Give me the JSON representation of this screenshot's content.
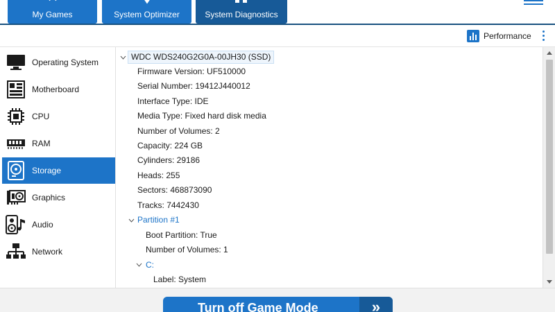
{
  "header": {
    "tabs": [
      {
        "label": "My Games",
        "icon": "gamepad-icon",
        "active": false
      },
      {
        "label": "System Optimizer",
        "icon": "wrench-icon",
        "active": false
      },
      {
        "label": "System Diagnostics",
        "icon": "diagnostics-icon",
        "active": true
      }
    ],
    "menu_icon": "hamburger-icon"
  },
  "toolbar": {
    "performance_label": "Performance",
    "performance_icon": "bar-chart-icon",
    "more_icon": "kebab-menu-icon"
  },
  "sidebar": {
    "items": [
      {
        "label": "Operating System",
        "icon": "monitor-icon",
        "active": false
      },
      {
        "label": "Motherboard",
        "icon": "motherboard-icon",
        "active": false
      },
      {
        "label": "CPU",
        "icon": "cpu-chip-icon",
        "active": false
      },
      {
        "label": "RAM",
        "icon": "ram-module-icon",
        "active": false
      },
      {
        "label": "Storage",
        "icon": "hard-disk-icon",
        "active": true
      },
      {
        "label": "Graphics",
        "icon": "graphics-card-icon",
        "active": false
      },
      {
        "label": "Audio",
        "icon": "speaker-icon",
        "active": false
      },
      {
        "label": "Network",
        "icon": "network-icon",
        "active": false
      }
    ]
  },
  "tree": {
    "root": "WDC WDS240G2G0A-00JH30 (SSD)",
    "properties": [
      "Firmware Version: UF510000",
      "Serial Number: 19412J440012",
      "Interface Type: IDE",
      "Media Type: Fixed hard disk media",
      "Number of Volumes: 2",
      "Capacity: 224 GB",
      "Cylinders: 29186",
      "Heads: 255",
      "Sectors: 468873090",
      "Tracks: 7442430"
    ],
    "partition": {
      "label": "Partition #1",
      "properties": [
        "Boot Partition: True",
        "Number of Volumes: 1"
      ],
      "volume": {
        "label": "C:",
        "properties": [
          "Label: System"
        ]
      }
    }
  },
  "bottom": {
    "game_mode_button": "Turn off Game Mode",
    "game_mode_arrow": "»"
  },
  "colors": {
    "accent": "#1d74c8",
    "accent_dark": "#175a98"
  }
}
